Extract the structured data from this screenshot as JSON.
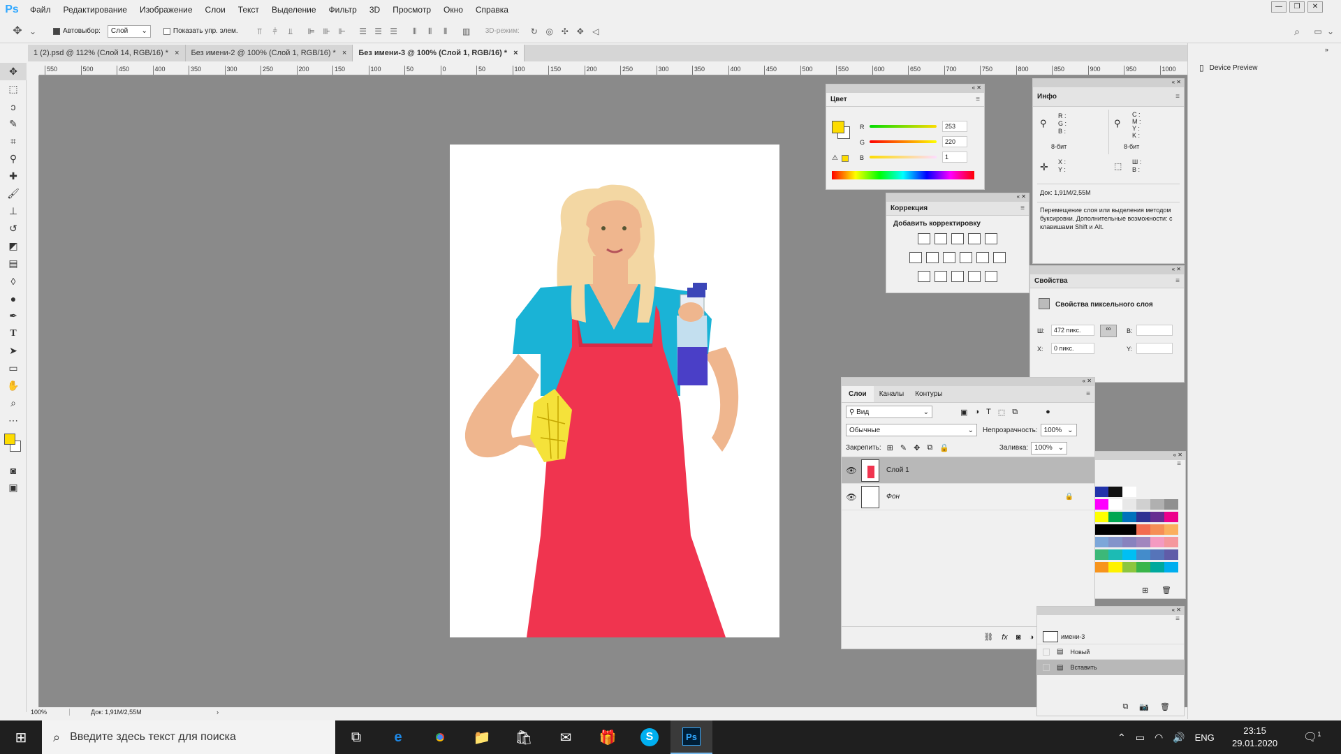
{
  "app": {
    "logo": "Ps"
  },
  "menu": [
    "Файл",
    "Редактирование",
    "Изображение",
    "Слои",
    "Текст",
    "Выделение",
    "Фильтр",
    "3D",
    "Просмотр",
    "Окно",
    "Справка"
  ],
  "options": {
    "autoselect_label": "Автовыбор:",
    "autoselect_value": "Слой",
    "show_transform_label": "Показать упр. элем.",
    "mode3d_label": "3D-режим:"
  },
  "tabs": [
    {
      "label": "1 (2).psd @ 112% (Слой 14, RGB/16) *",
      "close": "×"
    },
    {
      "label": "Без имени-2 @ 100% (Слой 1, RGB/16) *",
      "close": "×"
    },
    {
      "label": "Без имени-3 @ 100% (Слой 1, RGB/16) *",
      "close": "×"
    }
  ],
  "ruler_h": [
    "550",
    "500",
    "450",
    "400",
    "350",
    "300",
    "250",
    "200",
    "150",
    "100",
    "50",
    "0",
    "50",
    "100",
    "150",
    "200",
    "250",
    "300",
    "350",
    "400",
    "450",
    "500",
    "550",
    "600",
    "650",
    "700",
    "750",
    "800",
    "850",
    "900",
    "950",
    "1000"
  ],
  "status": {
    "zoom": "100%",
    "doc": "Док: 1,91M/2,55M",
    "arrow": "›"
  },
  "color_panel": {
    "title": "Цвет",
    "r_label": "R",
    "g_label": "G",
    "b_label": "B",
    "r": "253",
    "g": "220",
    "b": "1"
  },
  "correction_panel": {
    "title": "Коррекция",
    "subtitle": "Добавить корректировку"
  },
  "info_panel": {
    "title": "Инфо",
    "rgb_labels": "R :\nG :\nB :",
    "cmyk_labels": "C :\nM :\nY :\nK :",
    "bits_left": "8-бит",
    "bits_right": "8-бит",
    "xy_labels": "X :\nY :",
    "wh_labels": "Ш :\nВ :",
    "doc": "Док: 1,91M/2,55M",
    "hint": "Перемещение слоя или выделения методом буксировки. Дополнительные возможности: с клавишами Shift и Alt."
  },
  "properties_panel": {
    "title": "Свойства",
    "subtitle": "Свойства пиксельного слоя",
    "w_label": "Ш:",
    "w_value": "472 пикс.",
    "h_label": "В:",
    "x_label": "X:",
    "x_value": "0 пикс.",
    "y_label": "Y:"
  },
  "layers_panel": {
    "tabs": [
      "Слои",
      "Каналы",
      "Контуры"
    ],
    "filter": "Вид",
    "blend": "Обычные",
    "opacity_label": "Непрозрачность:",
    "opacity": "100%",
    "lock_label": "Закрепить:",
    "fill_label": "Заливка:",
    "fill": "100%",
    "layers": [
      {
        "name": "Слой 1"
      },
      {
        "name": "Фон"
      }
    ]
  },
  "history_panel": {
    "doc": "имени-3",
    "items": [
      "Новый",
      "Вставить"
    ]
  },
  "device_preview": {
    "label": "Device Preview"
  },
  "taskbar": {
    "search_placeholder": "Введите здесь текст для поиска",
    "lang": "ENG",
    "time": "23:15",
    "date": "29.01.2020",
    "notif": "1"
  },
  "colors": {
    "foreground": "#fddc01",
    "apron": "#f0344f",
    "shirt": "#1ab3d6",
    "hair": "#f3d7a3",
    "skin": "#efb68e"
  }
}
